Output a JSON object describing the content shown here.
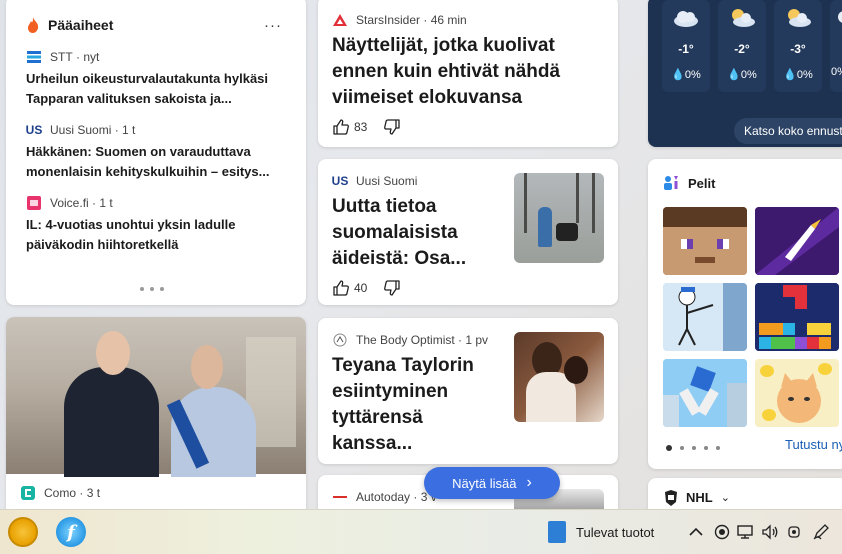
{
  "top_stories": {
    "title": "Pääaiheet",
    "more": "···",
    "items": [
      {
        "source": "STT",
        "time": "nyt",
        "headline": "Urheilun oikeusturvalautakunta hylkäsi Tapparan valituksen sakoista ja..."
      },
      {
        "source": "Uusi Suomi",
        "time": "1 t",
        "headline": "Häkkänen: Suomen on varauduttava monenlaisin kehityskulkuihin – esitys..."
      },
      {
        "source": "Voice.fi",
        "time": "1 t",
        "headline": "IL: 4-vuotias unohtui yksin ladulle päiväkodin hiihtoretkellä"
      }
    ]
  },
  "photo_card": {
    "source": "Como",
    "time": "3 t"
  },
  "articles": [
    {
      "source": "StarsInsider",
      "time": "46 min",
      "headline": "Näyttelijät, jotka kuolivat ennen kuin ehtivät nähdä viimeiset elokuvansa",
      "likes": "83"
    },
    {
      "source": "Uusi Suomi",
      "time": "",
      "headline": "Uutta tietoa suomalaisista äideistä: Osa...",
      "likes": "40"
    },
    {
      "source": "The Body Optimist",
      "time": "1 pv",
      "headline": "Teyana Taylorin esiintyminen tyttärensä kanssa...",
      "likes": ""
    },
    {
      "source": "Autotoday",
      "time": "3 v"
    }
  ],
  "show_more": {
    "label": "Näytä lisää",
    "chevron": "›"
  },
  "weather": {
    "hours": [
      {
        "temp": "-1°",
        "precip": "0%"
      },
      {
        "temp": "-2°",
        "precip": "0%"
      },
      {
        "temp": "-3°",
        "precip": "0%"
      }
    ],
    "partial_precip": "0%",
    "link": "Katso koko ennuste"
  },
  "games": {
    "title": "Pelit",
    "explore": "Tutustu nyt"
  },
  "nhl": {
    "label": "NHL",
    "chevron": "⌄"
  },
  "taskbar": {
    "upcoming": "Tulevat tuotot",
    "app2_glyph": "f"
  },
  "colors": {
    "accent": "#3b6ee0",
    "weather_bg": "#1d3150"
  }
}
